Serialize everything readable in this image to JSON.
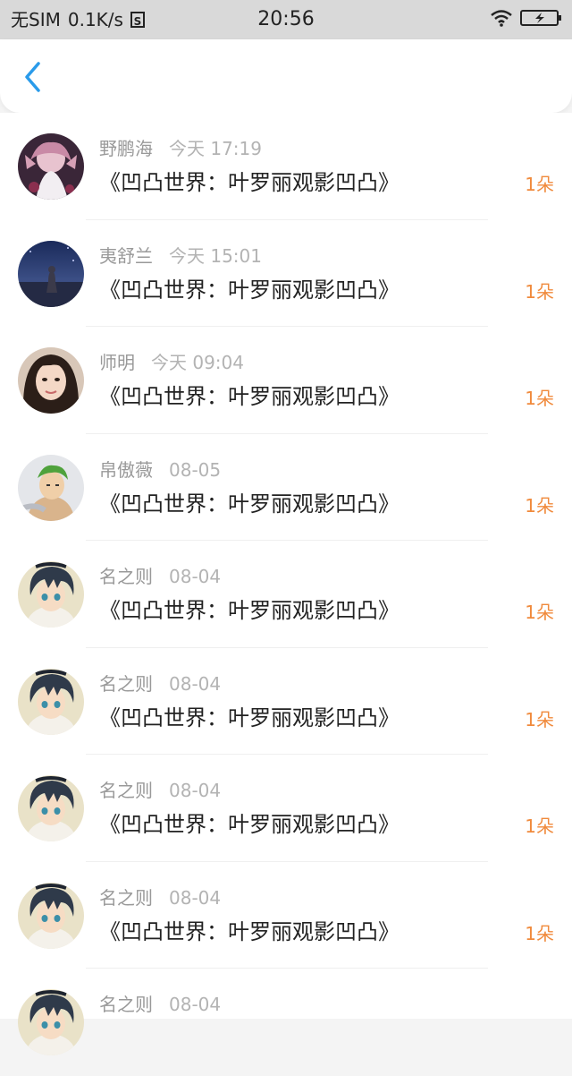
{
  "status_bar": {
    "carrier": "无SIM",
    "network_speed": "0.1K/s",
    "sim_icon": "s-box-icon",
    "time": "20:56",
    "wifi_icon": "wifi-icon",
    "battery_icon": "battery-charging-icon"
  },
  "header": {
    "back_icon": "chevron-left-icon",
    "accent_color": "#2a9bea"
  },
  "accent_colors": {
    "count": "#f08a3c"
  },
  "items": [
    {
      "name": "野鹏海",
      "time": "今天 17:19",
      "title": "《凹凸世界：叶罗丽观影凹凸》",
      "count": "1朵",
      "avatar": "anime-girl-avatar"
    },
    {
      "name": "夷舒兰",
      "time": "今天 15:01",
      "title": "《凹凸世界：叶罗丽观影凹凸》",
      "count": "1朵",
      "avatar": "night-sky-avatar"
    },
    {
      "name": "师明",
      "time": "今天 09:04",
      "title": "《凹凸世界：叶罗丽观影凹凸》",
      "count": "1朵",
      "avatar": "woman-photo-avatar"
    },
    {
      "name": "帛傲薇",
      "time": "08-05",
      "title": "《凹凸世界：叶罗丽观影凹凸》",
      "count": "1朵",
      "avatar": "anime-swordsman-avatar"
    },
    {
      "name": "名之则",
      "time": "08-04",
      "title": "《凹凸世界：叶罗丽观影凹凸》",
      "count": "1朵",
      "avatar": "anime-boy-avatar"
    },
    {
      "name": "名之则",
      "time": "08-04",
      "title": "《凹凸世界：叶罗丽观影凹凸》",
      "count": "1朵",
      "avatar": "anime-boy-avatar"
    },
    {
      "name": "名之则",
      "time": "08-04",
      "title": "《凹凸世界：叶罗丽观影凹凸》",
      "count": "1朵",
      "avatar": "anime-boy-avatar"
    },
    {
      "name": "名之则",
      "time": "08-04",
      "title": "《凹凸世界：叶罗丽观影凹凸》",
      "count": "1朵",
      "avatar": "anime-boy-avatar"
    },
    {
      "name": "名之则",
      "time": "08-04",
      "title": "",
      "count": "",
      "avatar": "anime-boy-avatar"
    }
  ]
}
